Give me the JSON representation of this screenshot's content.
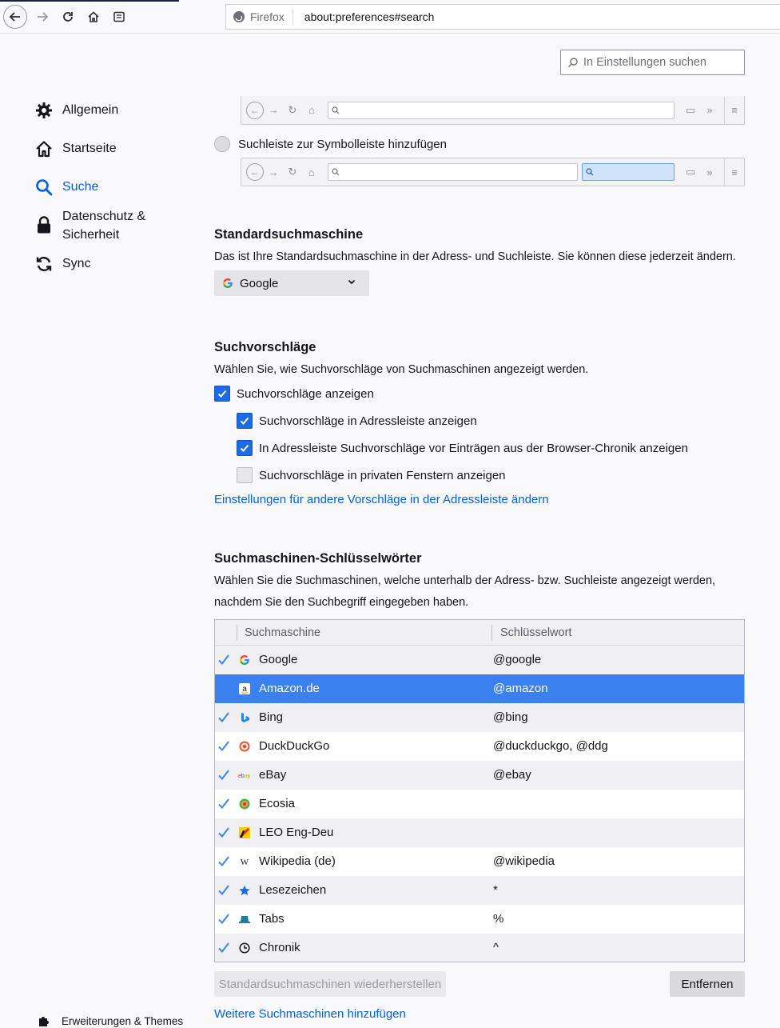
{
  "toolbar": {
    "identity_label": "Firefox",
    "url": "about:preferences#search"
  },
  "pref_search": {
    "placeholder": "In Einstellungen suchen"
  },
  "sidebar": {
    "items": [
      {
        "label": "Allgemein",
        "icon": "gear-icon"
      },
      {
        "label": "Startseite",
        "icon": "home-icon"
      },
      {
        "label": "Suche",
        "icon": "search-icon",
        "active": true
      },
      {
        "label": "Datenschutz & Sicherheit",
        "label_line1": "Datenschutz &",
        "label_line2": "Sicherheit",
        "icon": "lock-icon"
      },
      {
        "label": "Sync",
        "icon": "sync-icon"
      }
    ],
    "extensions_label": "Erweiterungen & Themes"
  },
  "searchbar_option": {
    "label": "Suchleiste zur Symbolleiste hinzufügen",
    "selected": false
  },
  "default_engine": {
    "heading": "Standardsuchmaschine",
    "description": "Das ist Ihre Standardsuchmaschine in der Adress- und Suchleiste. Sie können diese jederzeit ändern.",
    "selected": "Google"
  },
  "suggestions": {
    "heading": "Suchvorschläge",
    "description": "Wählen Sie, wie Suchvorschläge von Suchmaschinen angezeigt werden.",
    "options": [
      {
        "label": "Suchvorschläge anzeigen",
        "checked": true
      },
      {
        "label": "Suchvorschläge in Adressleiste anzeigen",
        "checked": true
      },
      {
        "label": "In Adressleiste Suchvorschläge vor Einträgen aus der Browser-Chronik anzeigen",
        "checked": true
      },
      {
        "label": "Suchvorschläge in privaten Fenstern anzeigen",
        "checked": false
      }
    ],
    "link": "Einstellungen für andere Vorschläge in der Adressleiste ändern"
  },
  "keywords": {
    "heading": "Suchmaschinen-Schlüsselwörter",
    "description_line1": "Wählen Sie die Suchmaschinen, welche unterhalb der Adress- bzw. Suchleiste angezeigt werden,",
    "description_line2": "nachdem Sie den Suchbegriff eingegeben haben.",
    "columns": [
      "Suchmaschine",
      "Schlüsselwort"
    ],
    "rows": [
      {
        "name": "Google",
        "keyword": "@google",
        "checked": true,
        "icon": "google-icon"
      },
      {
        "name": "Amazon.de",
        "keyword": "@amazon",
        "checked": false,
        "icon": "amazon-icon",
        "selected": true
      },
      {
        "name": "Bing",
        "keyword": "@bing",
        "checked": true,
        "icon": "bing-icon"
      },
      {
        "name": "DuckDuckGo",
        "keyword": "@duckduckgo, @ddg",
        "checked": true,
        "icon": "duckduckgo-icon"
      },
      {
        "name": "eBay",
        "keyword": "@ebay",
        "checked": true,
        "icon": "ebay-icon"
      },
      {
        "name": "Ecosia",
        "keyword": "",
        "checked": true,
        "icon": "ecosia-icon"
      },
      {
        "name": "LEO Eng-Deu",
        "keyword": "",
        "checked": true,
        "icon": "leo-icon"
      },
      {
        "name": "Wikipedia (de)",
        "keyword": "@wikipedia",
        "checked": true,
        "icon": "wikipedia-icon"
      },
      {
        "name": "Lesezeichen",
        "keyword": "*",
        "checked": true,
        "icon": "star-icon"
      },
      {
        "name": "Tabs",
        "keyword": "%",
        "checked": true,
        "icon": "tab-icon"
      },
      {
        "name": "Chronik",
        "keyword": "^",
        "checked": true,
        "icon": "clock-icon"
      }
    ],
    "restore_button": "Standardsuchmaschinen wiederherstellen",
    "remove_button": "Entfernen",
    "add_link": "Weitere Suchmaschinen hinzufügen"
  },
  "colors": {
    "accent": "#0061e0",
    "selection": "#3a80ef",
    "checkbox": "#1d6ae5"
  }
}
